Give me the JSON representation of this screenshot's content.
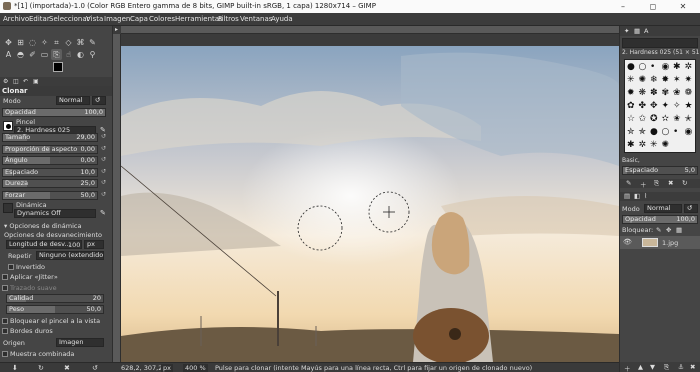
{
  "window": {
    "title": "*[1] (importada)-1.0 (Color RGB Entero gamma de 8 bits, GIMP built-in sRGB, 1 capa) 1280x714 – GIMP",
    "minimize": "–",
    "maximize": "◻",
    "close": "✕"
  },
  "menu": [
    "Archivo",
    "Editar",
    "Seleccionar",
    "Vista",
    "Imagen",
    "Capa",
    "Colores",
    "Herramientas",
    "Filtros",
    "Ventanas",
    "Ayuda"
  ],
  "tool_options": {
    "title": "Clonar",
    "mode_label": "Modo",
    "mode_value": "Normal",
    "opacity_label": "Opacidad",
    "opacity_value": "100,0",
    "brush_label": "Pincel",
    "brush_value": "2. Hardness 025",
    "sliders": [
      {
        "label": "Tamaño",
        "value": "29,00",
        "fill": 0.25
      },
      {
        "label": "Proporción de aspecto",
        "value": "0,00",
        "fill": 0.5
      },
      {
        "label": "Ángulo",
        "value": "0,00",
        "fill": 0.5
      },
      {
        "label": "Espaciado",
        "value": "10,0",
        "fill": 0.1
      },
      {
        "label": "Dureza",
        "value": "25,0",
        "fill": 0.25
      },
      {
        "label": "Forzar",
        "value": "50,0",
        "fill": 0.5
      }
    ],
    "dynamics_label": "Dinámica",
    "dynamics_value": "Dynamics Off",
    "dynamics_options": "Opciones de dinámica",
    "fade_options": "Opciones de desvanecimiento",
    "fade_length_label": "Longitud de desv...",
    "fade_length_value": "100",
    "fade_length_unit": "px",
    "repeat_label": "Repetir",
    "repeat_value": "Ninguno (extendido)",
    "invert_label": "Invertido",
    "jitter_label": "Aplicar «Jitter»",
    "smooth_label": "Trazado suave",
    "quality_label": "Calidad",
    "quality_value": "20",
    "weight_label": "Peso",
    "weight_value": "50,0",
    "lock_brush_label": "Bloquear el pincel a la vista",
    "hard_edges_label": "Bordes duros",
    "source_label": "Origen",
    "source_value": "Imagen",
    "sample_merged_label": "Muestra combinada"
  },
  "right_dock": {
    "brush_name": "2. Hardness 025 (51 × 51)",
    "brush_set": "Basic,",
    "spacing_label": "Espaciado",
    "spacing_value": "5,0",
    "mode_label": "Modo",
    "mode_value": "Normal",
    "opacity_label": "Opacidad",
    "opacity_value": "100,0",
    "lock_label": "Bloquear:",
    "layer_name": "1.jpg"
  },
  "status": {
    "coords": "628,2, 307,2",
    "unit": "px",
    "zoom": "400 %",
    "message": "Pulse para clonar (intente Mayús para una línea recta, Ctrl para fijar un origen de clonado nuevo)"
  },
  "colors": {
    "accent": "#4a90d9",
    "sky_top": "#8aa4bf",
    "sky_bottom": "#f2e2c8"
  }
}
